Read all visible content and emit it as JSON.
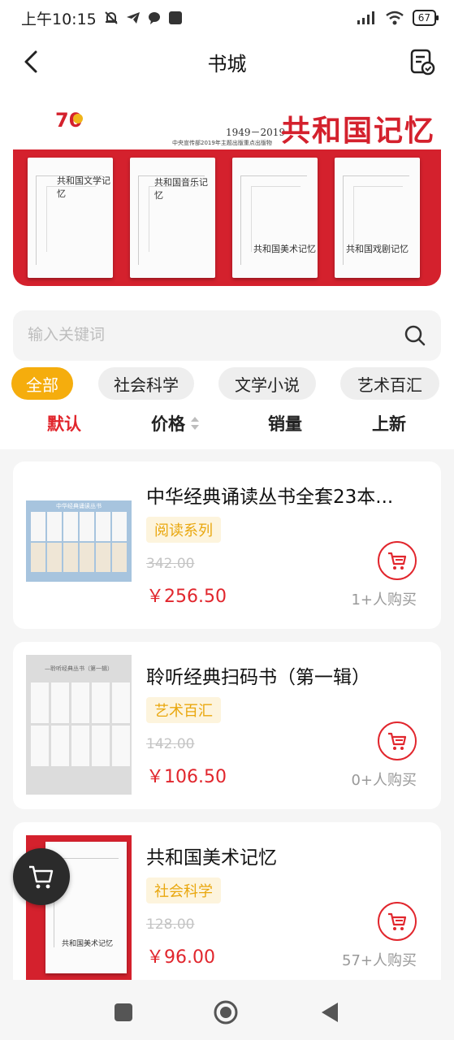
{
  "status_bar": {
    "time": "上午10:15",
    "battery": "67",
    "icons": [
      "mute-bell-icon",
      "telegram-icon",
      "chat-bubble-icon",
      "app-square-icon",
      "signal-icon",
      "wifi-icon",
      "battery-icon"
    ]
  },
  "nav": {
    "title": "书城",
    "back_icon": "back-arrow-icon",
    "orders_icon": "order-list-icon"
  },
  "banner": {
    "years": "1949－2019",
    "brand": "共和国记忆",
    "subtitle": "中央宣传部2019年主题出版重点出版物",
    "books": [
      "共和国文学记忆",
      "共和国音乐记忆",
      "共和国美术记忆",
      "共和国戏剧记忆"
    ]
  },
  "search": {
    "placeholder": "输入关键词",
    "icon": "search-icon"
  },
  "categories": [
    "全部",
    "社会科学",
    "文学小说",
    "艺术百汇"
  ],
  "active_category": "全部",
  "sorts": [
    {
      "label": "默认",
      "active": true
    },
    {
      "label": "价格",
      "active": false,
      "icon": "sort-arrows-icon"
    },
    {
      "label": "销量",
      "active": false
    },
    {
      "label": "上新",
      "active": false
    }
  ],
  "products": [
    {
      "title": "中华经典诵读丛书全套23本...",
      "tag": "阅读系列",
      "old_price": "342.00",
      "price": "￥256.50",
      "buyers": "1+人购买"
    },
    {
      "title": "聆听经典扫码书（第一辑）",
      "tag": "艺术百汇",
      "old_price": "142.00",
      "price": "￥106.50",
      "buyers": "0+人购买"
    },
    {
      "title": "共和国美术记忆",
      "tag": "社会科学",
      "old_price": "128.00",
      "price": "￥96.00",
      "buyers": "57+人购买"
    }
  ],
  "thumbs": {
    "p1_caption": "中华经典诵读丛书",
    "p2_caption": "—聆听经典丛书（第一辑）",
    "p3_book_title": "共和国美术记忆"
  },
  "colors": {
    "accent_red": "#e1262d",
    "chip_active": "#f5ad0d",
    "tag_text": "#e9a70e",
    "tag_bg": "#fdf4dd"
  },
  "system_nav": [
    "recents-square-icon",
    "home-circle-icon",
    "back-triangle-icon"
  ]
}
